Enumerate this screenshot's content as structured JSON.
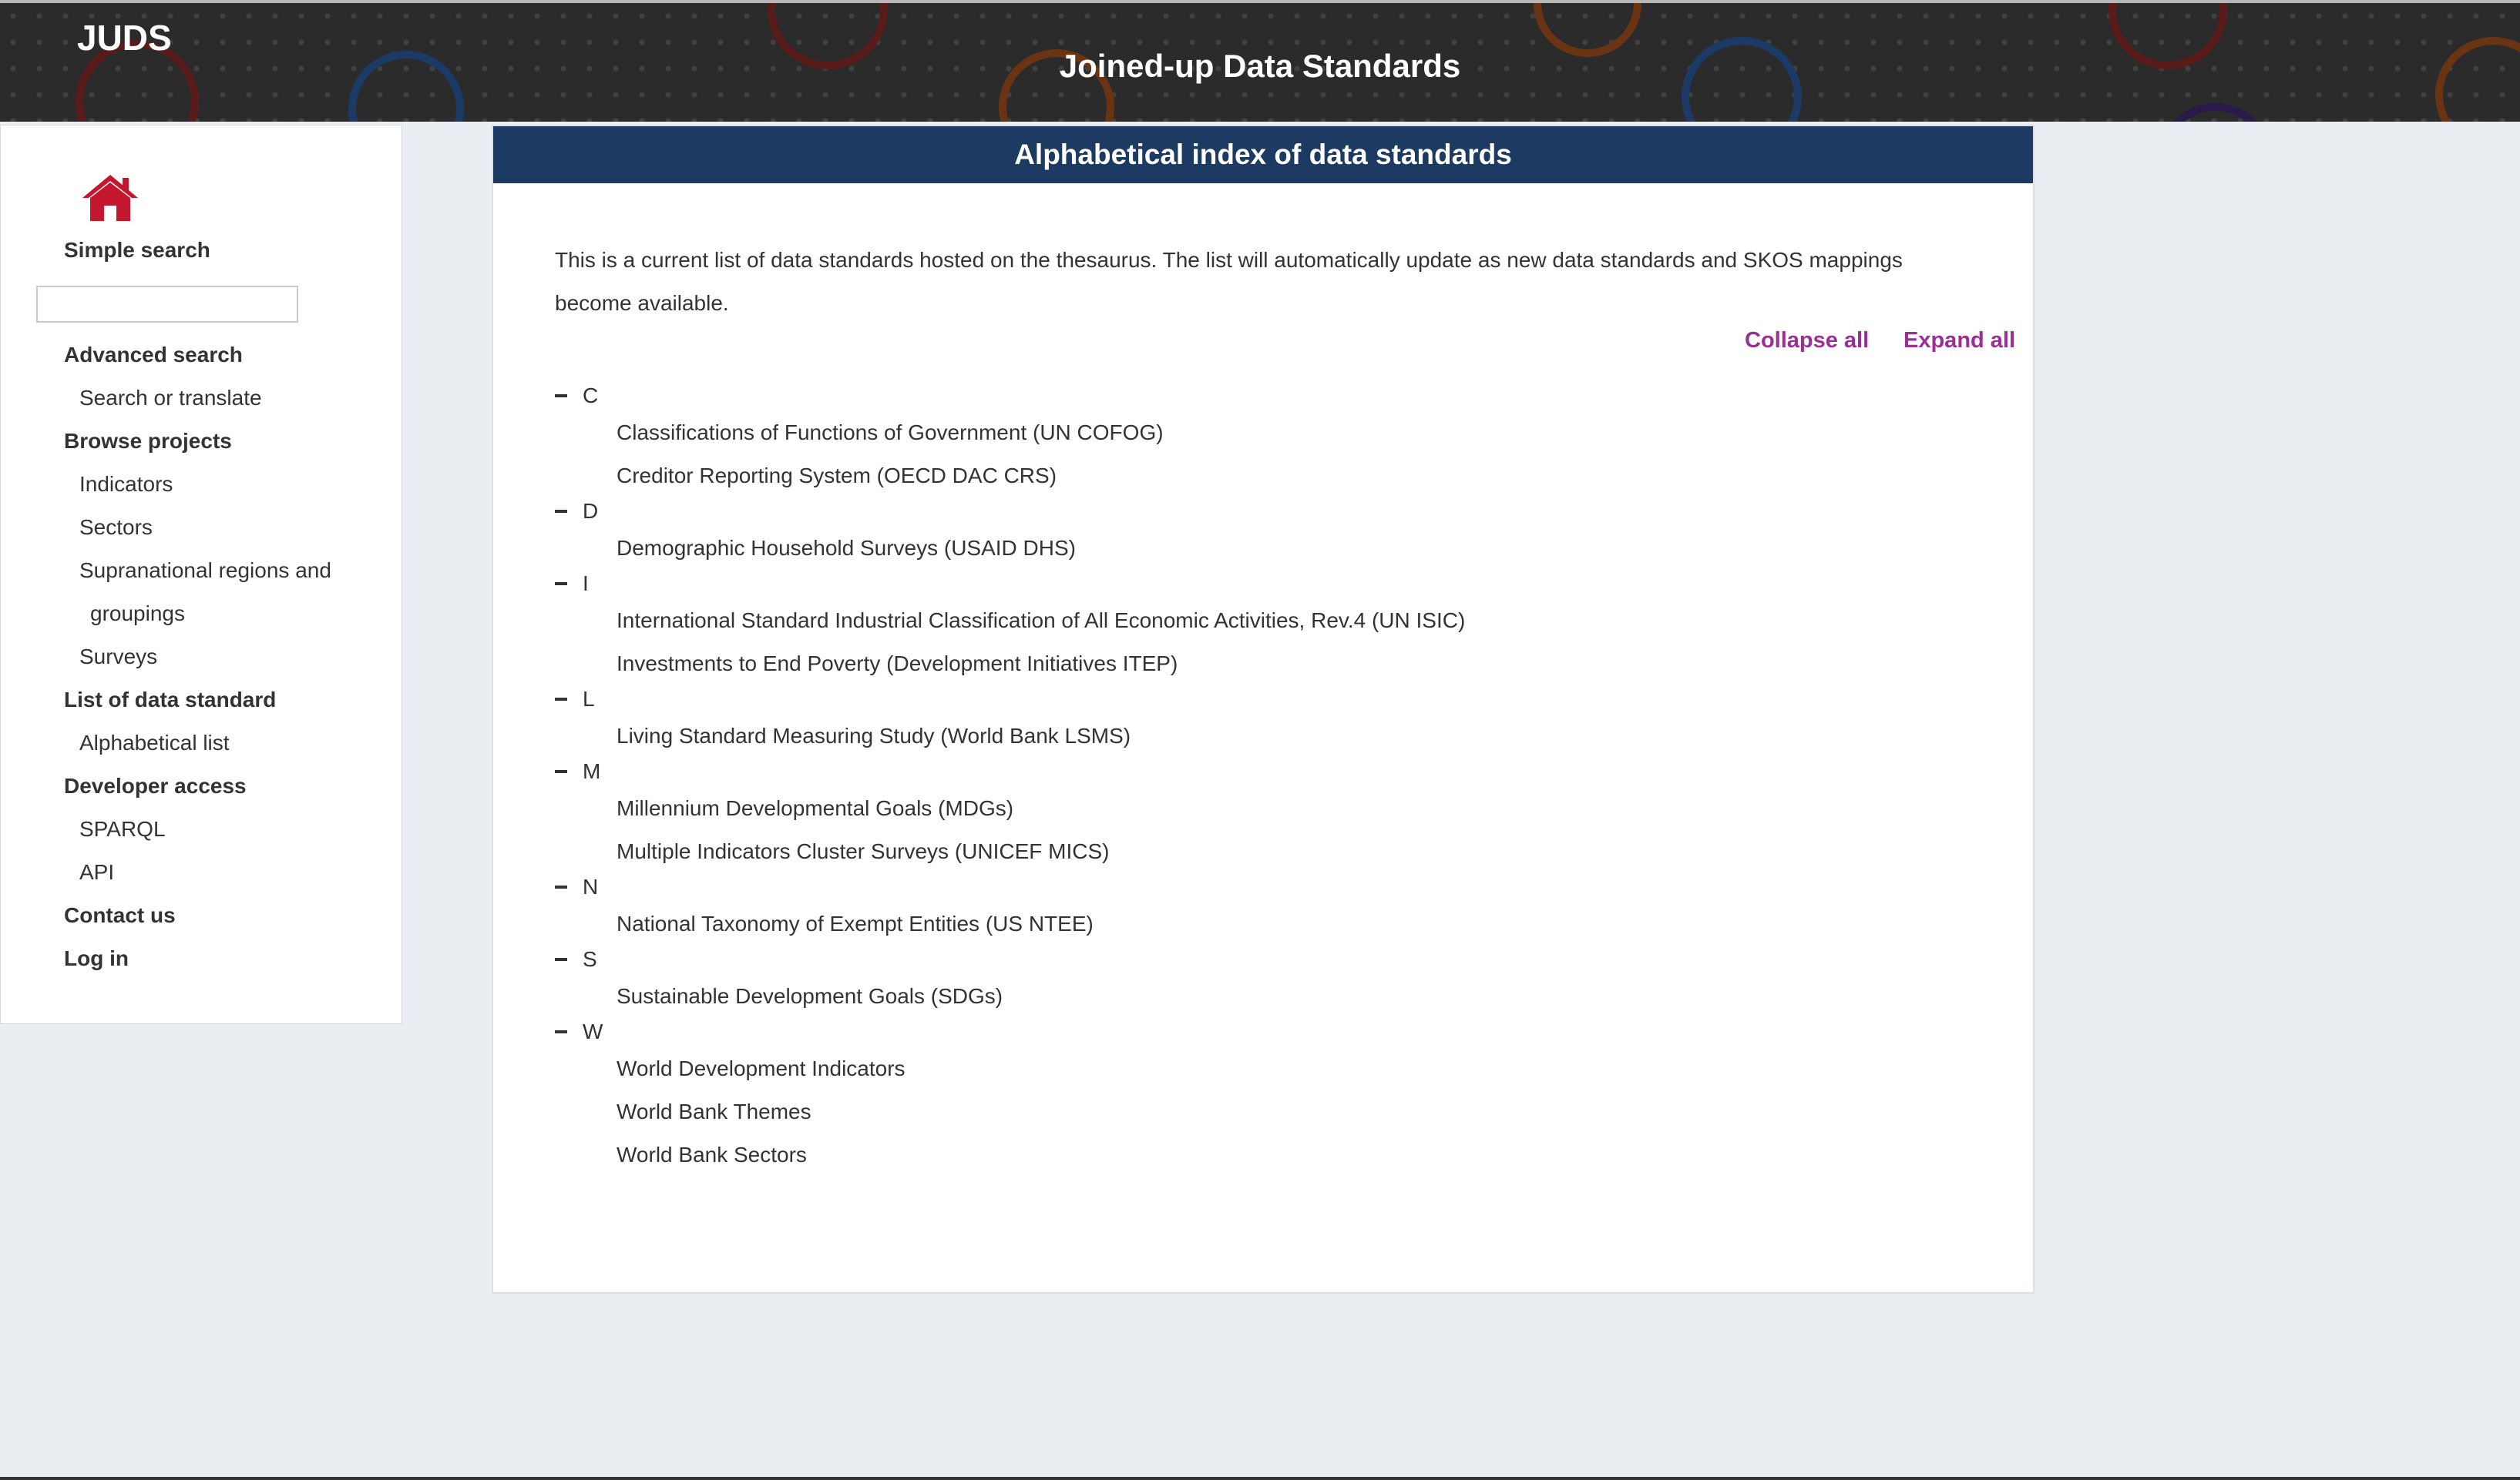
{
  "header": {
    "logo": "JUDS",
    "title": "Joined-up Data Standards"
  },
  "sidebar": {
    "simple_search_label": "Simple search",
    "search_value": "",
    "advanced_search": "Advanced search",
    "search_or_translate": "Search or translate",
    "browse_projects": "Browse projects",
    "indicators": "Indicators",
    "sectors": "Sectors",
    "supranational_line1": "Supranational regions and",
    "supranational_line2": "groupings",
    "surveys": "Surveys",
    "list_of_data_standard": "List of data standard",
    "alphabetical_list": "Alphabetical list",
    "developer_access": "Developer access",
    "sparql": "SPARQL",
    "api": "API",
    "contact_us": "Contact us",
    "log_in": "Log in"
  },
  "main": {
    "title": "Alphabetical index of data standards",
    "intro": "This is a current list of data standards hosted on the thesaurus. The list will automatically update as new data standards and SKOS mappings become available.",
    "collapse_all": "Collapse all",
    "expand_all": "Expand all",
    "groups": [
      {
        "letter": "C",
        "items": [
          "Classifications of Functions of Government (UN COFOG)",
          "Creditor Reporting System (OECD DAC CRS)"
        ]
      },
      {
        "letter": "D",
        "items": [
          "Demographic Household Surveys (USAID DHS)"
        ]
      },
      {
        "letter": "I",
        "items": [
          "International Standard Industrial Classification of All Economic Activities, Rev.4 (UN ISIC)",
          "Investments to End Poverty (Development Initiatives ITEP)"
        ]
      },
      {
        "letter": "L",
        "items": [
          "Living Standard Measuring Study (World Bank LSMS)"
        ]
      },
      {
        "letter": "M",
        "items": [
          "Millennium Developmental Goals (MDGs)",
          "Multiple Indicators Cluster Surveys (UNICEF MICS)"
        ]
      },
      {
        "letter": "N",
        "items": [
          "National Taxonomy of Exempt Entities (US NTEE)"
        ]
      },
      {
        "letter": "S",
        "items": [
          "Sustainable Development Goals (SDGs)"
        ]
      },
      {
        "letter": "W",
        "items": [
          "World Development Indicators",
          "World Bank Themes",
          "World Bank Sectors"
        ]
      }
    ]
  },
  "colors": {
    "header_bg": "#2b2b2b",
    "panel_header_bg": "#1d3a63",
    "link_purple": "#9a2f96",
    "home_icon_red": "#c4172d"
  },
  "icons": {
    "home": "home-icon",
    "collapse": "collapse-minus-icon"
  }
}
